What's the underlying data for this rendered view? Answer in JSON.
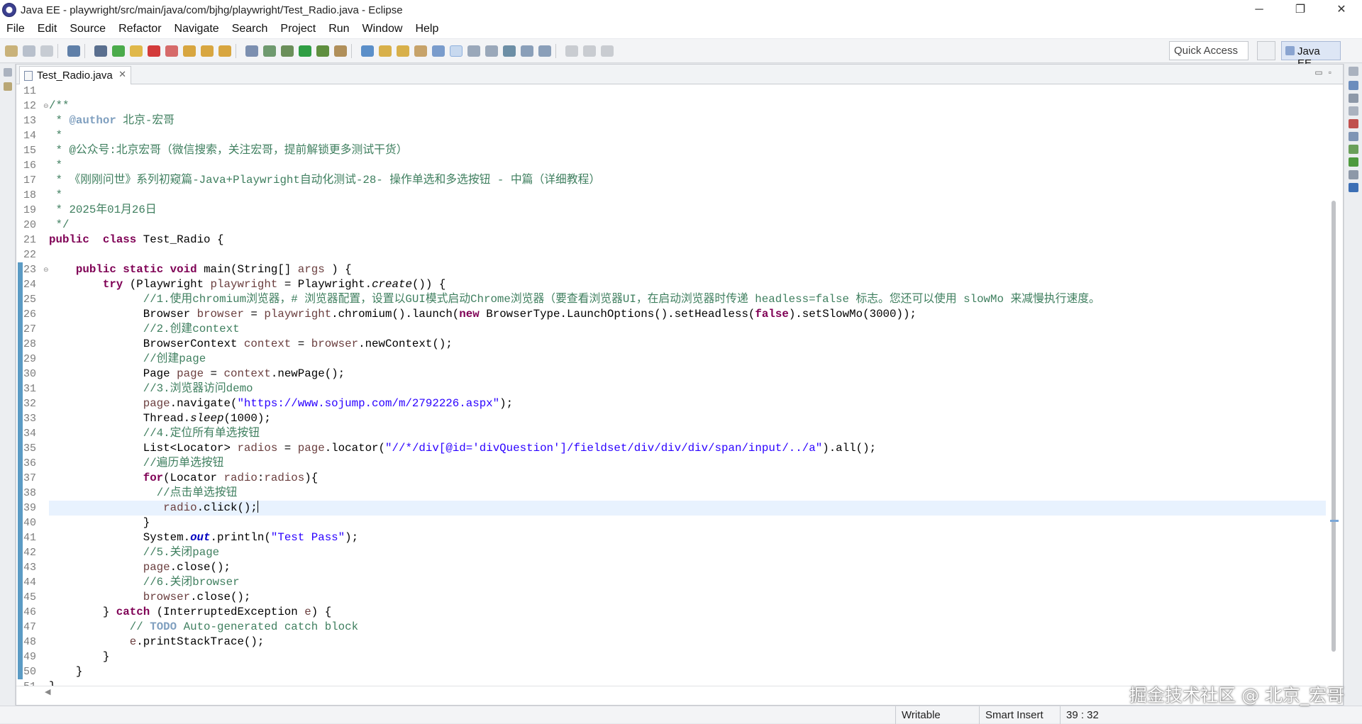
{
  "window": {
    "title": "Java EE - playwright/src/main/java/com/bjhg/playwright/Test_Radio.java - Eclipse",
    "minimize": "─",
    "restore": "❐",
    "close": "✕"
  },
  "menu": [
    "File",
    "Edit",
    "Source",
    "Refactor",
    "Navigate",
    "Search",
    "Project",
    "Run",
    "Window",
    "Help"
  ],
  "toolbar": {
    "quick_access_placeholder": "Quick Access",
    "perspective": "Java EE"
  },
  "editor": {
    "tab_label": "Test_Radio.java",
    "tab_close": "✕",
    "current_line": 39,
    "first_line": 11,
    "line_numbers": [
      "11",
      "12",
      "13",
      "14",
      "15",
      "16",
      "17",
      "18",
      "19",
      "20",
      "21",
      "22",
      "23",
      "24",
      "25",
      "26",
      "27",
      "28",
      "29",
      "30",
      "31",
      "32",
      "33",
      "34",
      "35",
      "36",
      "37",
      "38",
      "39",
      "40",
      "41",
      "42",
      "43",
      "44",
      "45",
      "46",
      "47",
      "48",
      "49",
      "50",
      "51"
    ],
    "code": [
      [],
      [
        [
          "cm",
          "/**"
        ]
      ],
      [
        [
          "cm",
          " * "
        ],
        [
          "tag",
          "@author"
        ],
        [
          "cm",
          " 北京-宏哥"
        ]
      ],
      [
        [
          "cm",
          " *"
        ]
      ],
      [
        [
          "cm",
          " * @公众号:北京宏哥（微信搜索，关注宏哥，提前解锁更多测试干货）"
        ]
      ],
      [
        [
          "cm",
          " *"
        ]
      ],
      [
        [
          "cm",
          " * 《刚刚问世》系列初窥篇-Java+Playwright自动化测试-28- 操作单选和多选按钮 - 中篇（详细教程）"
        ]
      ],
      [
        [
          "cm",
          " *"
        ]
      ],
      [
        [
          "cm",
          " * 2025年01月26日"
        ]
      ],
      [
        [
          "cm",
          " */"
        ]
      ],
      [
        [
          "kw",
          "public"
        ],
        [
          "",
          "  "
        ],
        [
          "kw",
          "class"
        ],
        [
          "",
          " Test_Radio {"
        ]
      ],
      [],
      [
        [
          "",
          "    "
        ],
        [
          "kw",
          "public"
        ],
        [
          "",
          " "
        ],
        [
          "kw",
          "static"
        ],
        [
          "",
          " "
        ],
        [
          "kw",
          "void"
        ],
        [
          "",
          " main(String[] "
        ],
        [
          "va",
          "args"
        ],
        [
          "",
          " ) {"
        ]
      ],
      [
        [
          "",
          "        "
        ],
        [
          "kw",
          "try"
        ],
        [
          "",
          " (Playwright "
        ],
        [
          "va",
          "playwright"
        ],
        [
          "",
          " = Playwright."
        ],
        [
          "sm",
          "create"
        ],
        [
          "",
          "()) {"
        ]
      ],
      [
        [
          "",
          "              "
        ],
        [
          "cm",
          "//1.使用chromium浏览器，# 浏览器配置，设置以GUI模式启动Chrome浏览器（要查看浏览器UI，在启动浏览器时传递 headless=false 标志。您还可以使用 slowMo 来减慢执行速度。"
        ]
      ],
      [
        [
          "",
          "              Browser "
        ],
        [
          "va",
          "browser"
        ],
        [
          "",
          " = "
        ],
        [
          "va",
          "playwright"
        ],
        [
          "",
          ".chromium().launch("
        ],
        [
          "kw",
          "new"
        ],
        [
          "",
          " BrowserType.LaunchOptions().setHeadless("
        ],
        [
          "kw",
          "false"
        ],
        [
          "",
          ").setSlowMo(3000));"
        ]
      ],
      [
        [
          "",
          "              "
        ],
        [
          "cm",
          "//2.创建context"
        ]
      ],
      [
        [
          "",
          "              BrowserContext "
        ],
        [
          "va",
          "context"
        ],
        [
          "",
          " = "
        ],
        [
          "va",
          "browser"
        ],
        [
          "",
          ".newContext();"
        ]
      ],
      [
        [
          "",
          "              "
        ],
        [
          "cm",
          "//创建page"
        ]
      ],
      [
        [
          "",
          "              Page "
        ],
        [
          "va",
          "page"
        ],
        [
          "",
          " = "
        ],
        [
          "va",
          "context"
        ],
        [
          "",
          ".newPage();"
        ]
      ],
      [
        [
          "",
          "              "
        ],
        [
          "cm",
          "//3.浏览器访问demo"
        ]
      ],
      [
        [
          "",
          "              "
        ],
        [
          "va",
          "page"
        ],
        [
          "",
          ".navigate("
        ],
        [
          "st",
          "\"https://www.sojump.com/m/2792226.aspx\""
        ],
        [
          "",
          ");"
        ]
      ],
      [
        [
          "",
          "              Thread."
        ],
        [
          "sm",
          "sleep"
        ],
        [
          "",
          "(1000);"
        ]
      ],
      [
        [
          "",
          "              "
        ],
        [
          "cm",
          "//4.定位所有单选按钮"
        ]
      ],
      [
        [
          "",
          "              List<Locator> "
        ],
        [
          "va",
          "radios"
        ],
        [
          "",
          " = "
        ],
        [
          "va",
          "page"
        ],
        [
          "",
          ".locator("
        ],
        [
          "st",
          "\"//*/div[@id='divQuestion']/fieldset/div/div/div/span/input/../a\""
        ],
        [
          "",
          ").all();"
        ]
      ],
      [
        [
          "",
          "              "
        ],
        [
          "cm",
          "//遍历单选按钮"
        ]
      ],
      [
        [
          "",
          "              "
        ],
        [
          "kw",
          "for"
        ],
        [
          "",
          "(Locator "
        ],
        [
          "va",
          "radio"
        ],
        [
          "",
          ":"
        ],
        [
          "va",
          "radios"
        ],
        [
          "",
          "){"
        ]
      ],
      [
        [
          "",
          "                "
        ],
        [
          "cm",
          "//点击单选按钮"
        ]
      ],
      [
        [
          "",
          "                 "
        ],
        [
          "va",
          "radio"
        ],
        [
          "",
          ".click();"
        ],
        [
          "caret",
          ""
        ]
      ],
      [
        [
          "",
          "              }"
        ]
      ],
      [
        [
          "",
          "              System."
        ],
        [
          "fi",
          "out"
        ],
        [
          "",
          ".println("
        ],
        [
          "st",
          "\"Test Pass\""
        ],
        [
          "",
          ");"
        ]
      ],
      [
        [
          "",
          "              "
        ],
        [
          "cm",
          "//5.关闭page"
        ]
      ],
      [
        [
          "",
          "              "
        ],
        [
          "va",
          "page"
        ],
        [
          "",
          ".close();"
        ]
      ],
      [
        [
          "",
          "              "
        ],
        [
          "cm",
          "//6.关闭browser"
        ]
      ],
      [
        [
          "",
          "              "
        ],
        [
          "va",
          "browser"
        ],
        [
          "",
          ".close();"
        ]
      ],
      [
        [
          "",
          "        } "
        ],
        [
          "kw",
          "catch"
        ],
        [
          "",
          " (InterruptedException "
        ],
        [
          "va",
          "e"
        ],
        [
          "",
          ") {"
        ]
      ],
      [
        [
          "",
          "            "
        ],
        [
          "cm",
          "// "
        ],
        [
          "todo",
          "TODO"
        ],
        [
          "cm",
          " Auto-generated catch block"
        ]
      ],
      [
        [
          "",
          "            "
        ],
        [
          "va",
          "e"
        ],
        [
          "",
          ".printStackTrace();"
        ]
      ],
      [
        [
          "",
          "        }"
        ]
      ],
      [
        [
          "",
          "    }"
        ]
      ],
      [
        [
          "",
          "}"
        ]
      ]
    ]
  },
  "status": {
    "writable": "Writable",
    "insert_mode": "Smart Insert",
    "cursor_position": "39 : 32"
  },
  "watermark": "掘金技术社区 @ 北京_宏哥"
}
